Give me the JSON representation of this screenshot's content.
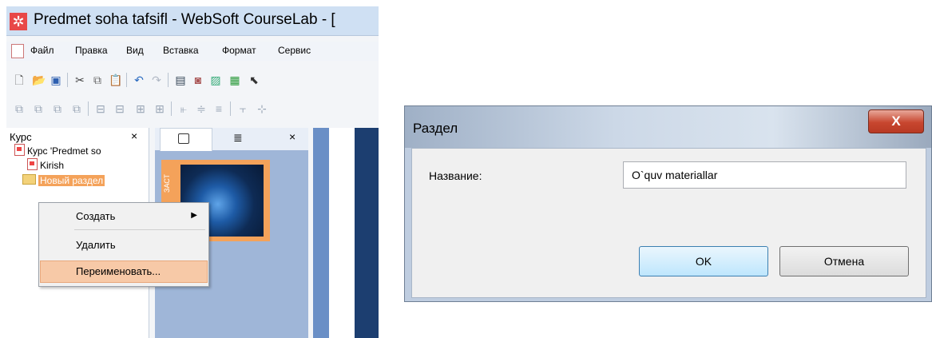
{
  "app": {
    "title": "Predmet soha tafsifl - WebSoft CourseLab - [",
    "icon": "coursea-app-icon",
    "menu": [
      "Файл",
      "Правка",
      "Вид",
      "Вставка",
      "Формат",
      "Сервис"
    ],
    "toolbar1_icons": [
      "new-icon",
      "open-icon",
      "save-icon",
      "cut-icon",
      "copy-icon",
      "paste-icon",
      "undo-icon",
      "redo-icon",
      "text-box-icon",
      "image-icon",
      "picture-icon",
      "chart-icon",
      "pointer-icon"
    ],
    "toolbar2_icons": [
      "bring-front-icon",
      "send-back-icon",
      "bring-forward-icon",
      "send-backward-icon",
      "align-left-icon",
      "align-center-icon",
      "align-middle-icon",
      "align-right-icon",
      "distribute-h-icon",
      "distribute-v-icon",
      "align-top-icon",
      "align-bottom-icon",
      "group-icon"
    ]
  },
  "course_pane": {
    "title": "Курс",
    "close": "×",
    "tree": {
      "root": "Курс 'Predmet so",
      "child": "Kirish",
      "selected_folder": "Новый раздел"
    }
  },
  "mid_pane": {
    "close": "×",
    "slide_tag": "ЗАСТ"
  },
  "context_menu": {
    "create": "Создать",
    "delete": "Удалить",
    "rename": "Переименовать..."
  },
  "dialog": {
    "title": "Раздел",
    "close": "X",
    "name_label": "Название:",
    "name_value": "O`quv materiallar",
    "ok": "OK",
    "cancel": "Отмена"
  },
  "colors": {
    "selection": "#f4a25a",
    "menu_highlight": "#f7c9a7",
    "dialog_frame": "#bfcde0",
    "close_button": "#c8462f"
  }
}
